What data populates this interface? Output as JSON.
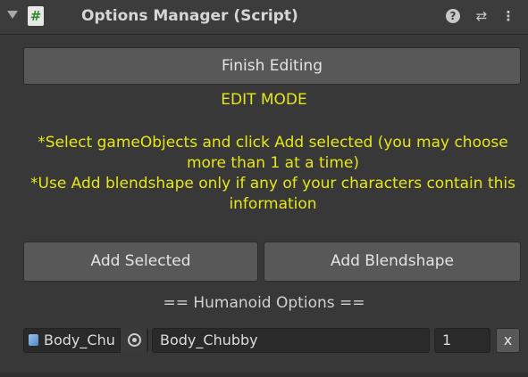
{
  "header": {
    "title": "Options Manager (Script)",
    "script_icon": "#",
    "icons": [
      "foldout-arrow-icon",
      "script-icon",
      "help-icon",
      "presets-icon",
      "kebab-menu-icon"
    ]
  },
  "buttons": {
    "finish_editing": "Finish Editing",
    "add_selected": "Add Selected",
    "add_blendshape": "Add Blendshape",
    "remove": "x"
  },
  "mode_label": "EDIT MODE",
  "instructions": [
    "*Select gameObjects and click Add selected (you may choose more than 1 at a time)",
    "*Use Add blendshape only if any of your characters contain this information"
  ],
  "section_title": "== Humanoid Options ==",
  "options_row": {
    "object_field_value": "Body_Chu",
    "name_value": "Body_Chubby",
    "number_value": "1"
  },
  "colors": {
    "background": "#383838",
    "accent_yellow": "#e6e61a",
    "button": "#585858"
  }
}
